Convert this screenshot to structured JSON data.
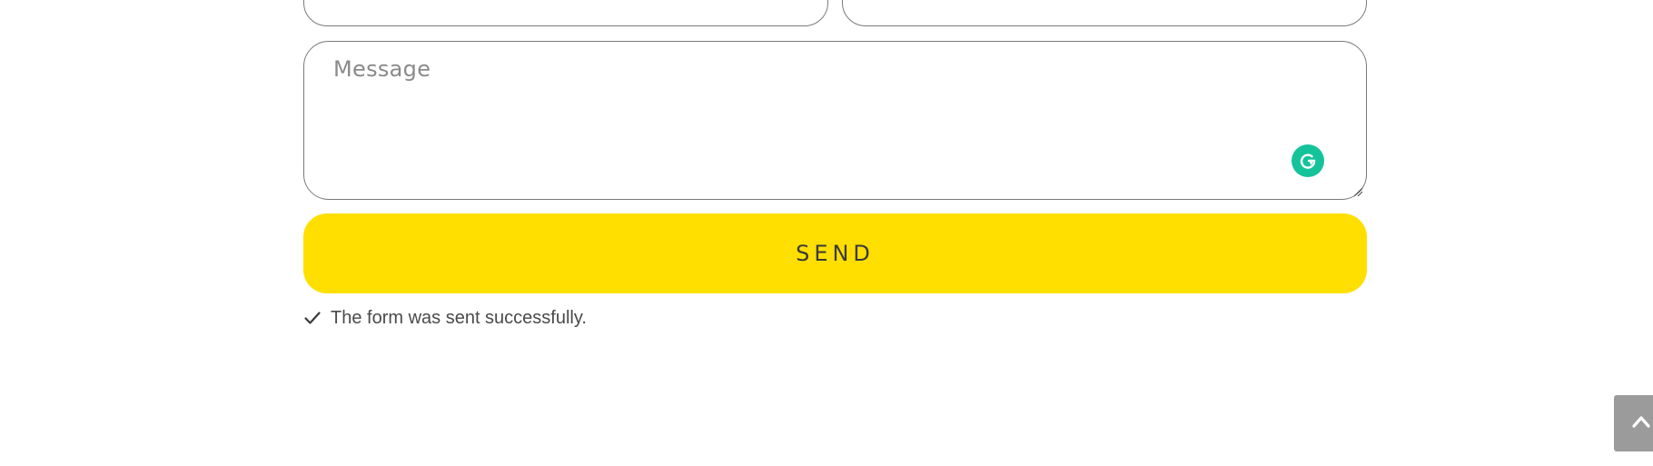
{
  "form": {
    "message_placeholder": "Message",
    "send_label": "SEND",
    "status_message": "The form was sent successfully."
  },
  "icons": {
    "grammarly": "grammarly-icon",
    "status": "checkmark-icon",
    "scroll_top": "chevron-up-icon",
    "resize": "resize-handle-icon"
  },
  "colors": {
    "send_button": "#ffdf00",
    "grammarly": "#15c39a",
    "scroll_top_button": "#9b9b9b",
    "border": "#7a7a7a"
  }
}
